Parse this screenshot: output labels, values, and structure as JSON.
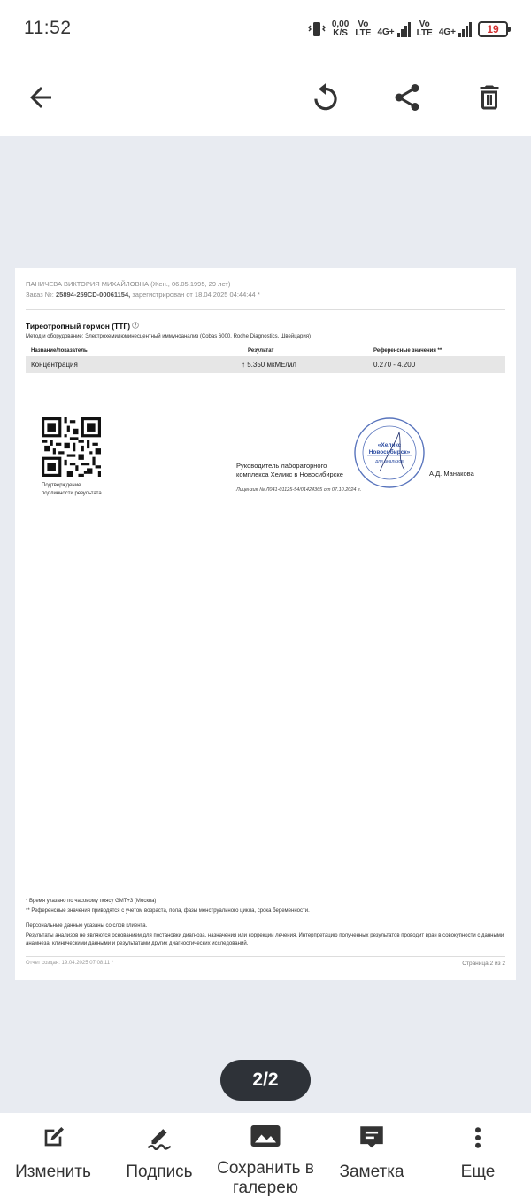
{
  "status_bar": {
    "time": "11:52",
    "net_speed_value": "0,00",
    "net_speed_unit": "K/S",
    "volte1_top": "Vo",
    "volte1_bottom": "LTE",
    "net1": "4G+",
    "volte2_top": "Vo",
    "volte2_bottom": "LTE",
    "net2": "4G+",
    "battery": "19"
  },
  "toolbar": {
    "back_icon": "arrow-left",
    "rotate_icon": "rotate",
    "share_icon": "share",
    "delete_icon": "trash"
  },
  "document": {
    "patient": "ПАНИЧЕВА ВИКТОРИЯ МИХАЙЛОВНА (Жен., 06.05.1995, 29 лет)",
    "order_prefix": "Заказ №:",
    "order_number": "25894-259CD-00061154,",
    "order_suffix": "зарегистрирован от 18.04.2025 04:44:44 *",
    "test_title": "Тиреотропный гормон (ТТГ)",
    "method": "Метод и оборудование: Электрохемилюминесцентный иммуноанализ (Cobas 6000, Roche Diagnostics, Швейцария)",
    "table_headers": [
      "Название/показатель",
      "Результат",
      "Референсные значения **"
    ],
    "row": {
      "name": "Концентрация",
      "result_arrow": "↑",
      "result": "5.350 мкМЕ/мл",
      "reference": "0.270 - 4.200"
    },
    "qr_caption_1": "Подтверждение",
    "qr_caption_2": "подлинности результата",
    "lab_head_1": "Руководитель лабораторного",
    "lab_head_2": "комплекса Хеликс в Новосибирске",
    "signer": "А.Д. Манакова",
    "license": "Лицензия № Л041-01125-54/01424365 от 07.10.2024 г.",
    "stamp_line1": "«Хеликс",
    "stamp_line2": "Новосибирск»",
    "stamp_line3": "для анализов",
    "footnote1": "* Время указано по часовому поясу GMT+3 (Москва)",
    "footnote2": "** Референсные значения приводятся с учетом возраста, пола, фазы менструального цикла, срока беременности.",
    "footnote3": "Персональные данные указаны со слов клиента.",
    "footnote4": "Результаты анализов не являются основанием для постановки диагноза, назначения или коррекции лечения. Интерпретацию полученных результатов проводит врач в совокупности с данными анамнеза, клиническими данными и результатами других диагностических исследований.",
    "created": "Отчет создан: 19.04.2025 07:08:11 *",
    "page_number": "Страница 2 из 2"
  },
  "page_indicator": "2/2",
  "bottom_actions": [
    {
      "label": "Изменить",
      "icon": "edit-icon"
    },
    {
      "label": "Подпись",
      "icon": "signature-icon"
    },
    {
      "label": "Сохранить в галерею",
      "icon": "image-icon"
    },
    {
      "label": "Заметка",
      "icon": "note-icon"
    },
    {
      "label": "Еще",
      "icon": "more-icon"
    }
  ]
}
